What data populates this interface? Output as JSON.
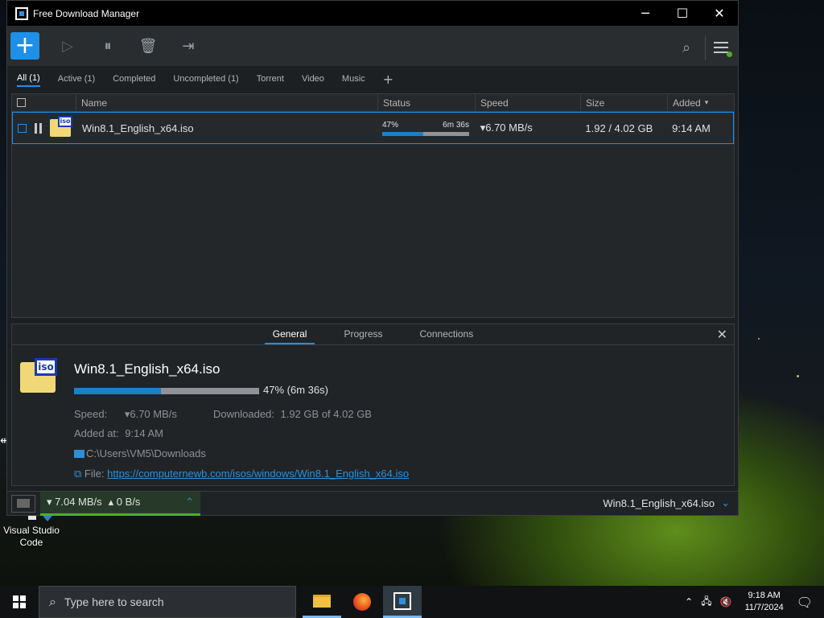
{
  "window": {
    "title": "Free Download Manager",
    "minimize": "─",
    "maximize": "☐",
    "close": "✕"
  },
  "toolbar": {
    "add": "+",
    "icons": [
      "play-icon",
      "pause-all-icon",
      "delete-icon",
      "move-icon",
      "search-icon",
      "menu-icon"
    ]
  },
  "filters": [
    {
      "label": "All (1)",
      "active": true
    },
    {
      "label": "Active (1)",
      "active": false
    },
    {
      "label": "Completed",
      "active": false
    },
    {
      "label": "Uncompleted (1)",
      "active": false
    },
    {
      "label": "Torrent",
      "active": false
    },
    {
      "label": "Video",
      "active": false
    },
    {
      "label": "Music",
      "active": false
    }
  ],
  "filters_add": "+",
  "columns": {
    "name": "Name",
    "status": "Status",
    "speed": "Speed",
    "size": "Size",
    "added": "Added"
  },
  "downloads": [
    {
      "name": "Win8.1_English_x64.iso",
      "icon_tag": "iso",
      "percent_label": "47%",
      "progress": 0.47,
      "remaining": "6m 36s",
      "speed": "▾6.70 MB/s",
      "size": "1.92 / 4.02 GB",
      "added": "9:14 AM"
    }
  ],
  "details": {
    "tabs": [
      "General",
      "Progress",
      "Connections"
    ],
    "close": "✕",
    "title": "Win8.1_English_x64.iso",
    "icon_tag": "iso",
    "progress": 0.47,
    "progress_label": "47% (6m 36s)",
    "speed_label": "Speed:",
    "speed_value": "▾6.70 MB/s",
    "downloaded_label": "Downloaded:",
    "downloaded_value": "1.92 GB of 4.02 GB",
    "added_label": "Added at:",
    "added_value": "9:14 AM",
    "folder": "C:\\Users\\VM5\\Downloads",
    "file_label": "File:",
    "file_url": "https://computernewb.com/isos/windows/Win8.1_English_x64.iso"
  },
  "statusbar": {
    "down": "▾ 7.04 MB/s",
    "up": "▴ 0 B/s",
    "current_file": "Win8.1_English_x64.iso"
  },
  "desktop": {
    "icon_label": "Visual Studio Code"
  },
  "taskbar": {
    "search_placeholder": "Type here to search",
    "time": "9:18 AM",
    "date": "11/7/2024"
  },
  "colors": {
    "accent": "#1e90e8",
    "progress": "#1a80c8",
    "online": "#4caf2a"
  }
}
